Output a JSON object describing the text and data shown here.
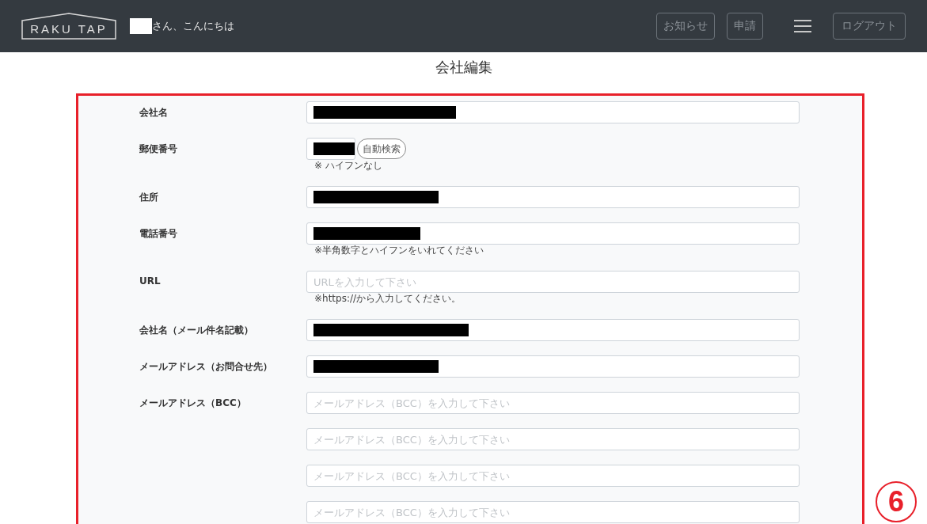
{
  "header": {
    "logo": "RAKU TAP",
    "user_redacted": true,
    "greeting": "さん、こんにちは",
    "buttons": [
      "お知らせ",
      "申請"
    ],
    "logout": "ログアウト"
  },
  "page_title": "会社編集",
  "form": {
    "rows": [
      {
        "label": "会社名",
        "fields": [
          {
            "redacted": true
          }
        ]
      },
      {
        "label": "郵便番号",
        "kind": "postal",
        "fields": [
          {
            "redacted": true
          }
        ],
        "button": "自動検索",
        "hint": "※ ハイフンなし"
      },
      {
        "label": "住所",
        "fields": [
          {
            "redacted": true
          }
        ]
      },
      {
        "label": "電話番号",
        "fields": [
          {
            "redacted": true
          }
        ],
        "hint": "※半角数字とハイフンをいれてください"
      },
      {
        "label": "URL",
        "fields": [
          {
            "redacted": false,
            "placeholder": "URLを入力して下さい"
          }
        ],
        "hint": "※https://から入力してください。"
      },
      {
        "label": "会社名（メール件名記載）",
        "fields": [
          {
            "redacted": true
          }
        ]
      },
      {
        "label": "メールアドレス（お問合せ先）",
        "fields": [
          {
            "redacted": true
          }
        ]
      },
      {
        "label": "メールアドレス（BCC）",
        "fields": [
          {
            "redacted": false,
            "placeholder": "メールアドレス（BCC）を入力して下さい"
          },
          {
            "redacted": false,
            "placeholder": "メールアドレス（BCC）を入力して下さい"
          },
          {
            "redacted": false,
            "placeholder": "メールアドレス（BCC）を入力して下さい"
          },
          {
            "redacted": false,
            "placeholder": "メールアドレス（BCC）を入力して下さい"
          }
        ]
      }
    ]
  },
  "annotation": {
    "number": "6"
  }
}
